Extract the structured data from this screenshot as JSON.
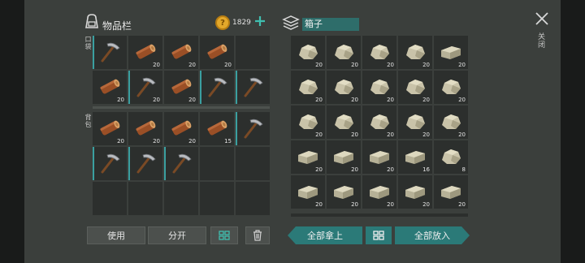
{
  "inventory": {
    "title": "物品栏",
    "coins": "1829",
    "plus_icon": "plus-icon",
    "bag_icon": "backpack-icon"
  },
  "pocket_label": "口袋",
  "backpack_label": "背包",
  "pocket_slots": [
    {
      "item": "pickaxe",
      "count": "",
      "durable": true
    },
    {
      "item": "log",
      "count": "20"
    },
    {
      "item": "log",
      "count": "20"
    },
    {
      "item": "log",
      "count": "20"
    },
    {
      "item": "",
      "count": ""
    },
    {
      "item": "log",
      "count": "20"
    },
    {
      "item": "pickaxe",
      "count": "20",
      "durable": true
    },
    {
      "item": "log",
      "count": "20"
    },
    {
      "item": "pickaxe",
      "count": "",
      "durable": true
    },
    {
      "item": "pickaxe",
      "count": "",
      "durable": true
    }
  ],
  "backpack_slots": [
    {
      "item": "log",
      "count": "20"
    },
    {
      "item": "log",
      "count": "20"
    },
    {
      "item": "log",
      "count": "20"
    },
    {
      "item": "log",
      "count": "15"
    },
    {
      "item": "pickaxe",
      "count": "",
      "durable": true
    },
    {
      "item": "pickaxe",
      "count": "",
      "durable": true
    },
    {
      "item": "pickaxe",
      "count": "",
      "durable": true
    },
    {
      "item": "pickaxe",
      "count": "",
      "durable": true
    },
    {
      "item": "",
      "count": ""
    },
    {
      "item": "",
      "count": ""
    },
    {
      "item": "",
      "count": ""
    },
    {
      "item": "",
      "count": ""
    },
    {
      "item": "",
      "count": ""
    },
    {
      "item": "",
      "count": ""
    },
    {
      "item": "",
      "count": ""
    }
  ],
  "chest": {
    "title": "箱子",
    "icon": "chest-icon",
    "slots": [
      {
        "item": "stone",
        "count": "20"
      },
      {
        "item": "stone",
        "count": "20"
      },
      {
        "item": "stone",
        "count": "20"
      },
      {
        "item": "stone",
        "count": "20"
      },
      {
        "item": "brick",
        "count": "20"
      },
      {
        "item": "stone",
        "count": "20"
      },
      {
        "item": "stone",
        "count": "20"
      },
      {
        "item": "stone",
        "count": "20"
      },
      {
        "item": "stone",
        "count": "20"
      },
      {
        "item": "stone",
        "count": "20"
      },
      {
        "item": "stone",
        "count": "20"
      },
      {
        "item": "stone",
        "count": "20"
      },
      {
        "item": "stone",
        "count": "20"
      },
      {
        "item": "stone",
        "count": "20"
      },
      {
        "item": "stone",
        "count": "20"
      },
      {
        "item": "brick",
        "count": "20"
      },
      {
        "item": "brick",
        "count": "20"
      },
      {
        "item": "brick",
        "count": "20"
      },
      {
        "item": "brick",
        "count": "16"
      },
      {
        "item": "stone",
        "count": "8"
      },
      {
        "item": "brick",
        "count": "20"
      },
      {
        "item": "brick",
        "count": "20"
      },
      {
        "item": "brick",
        "count": "20"
      },
      {
        "item": "brick",
        "count": "20"
      },
      {
        "item": "brick",
        "count": "20"
      }
    ]
  },
  "buttons": {
    "use": "使用",
    "split": "分开",
    "take_all": "全部拿上",
    "put_all": "全部放入"
  },
  "close_label": "关闭"
}
